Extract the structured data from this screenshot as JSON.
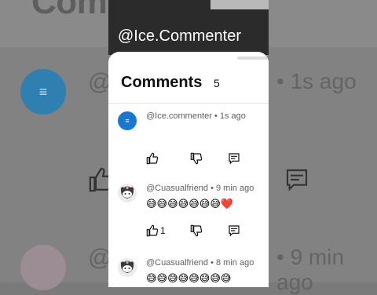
{
  "background": {
    "title": "Comme",
    "comment1": {
      "handle": "@",
      "time": "• 1s ago"
    },
    "comment2": {
      "handle": "@",
      "time": "• 9 min ago"
    }
  },
  "video_overlay_handle": "@Ice.Commenter",
  "panel": {
    "title": "Comments",
    "count": "5"
  },
  "comments": [
    {
      "meta": "@Ice.commenter • 1s ago",
      "text": "",
      "likes": ""
    },
    {
      "meta": "@Cuasualfriend • 9 min ago",
      "text": "😅😅😅😅😅😅😅❤️",
      "likes": "1"
    },
    {
      "meta": "@Cuasualfriend • 8 min ago",
      "text": "😅😅😅😅😅😅😅😅",
      "likes": ""
    }
  ],
  "icons": {
    "like": "thumbs-up-icon",
    "dislike": "thumbs-down-icon",
    "reply": "reply-icon",
    "avatar_blue": "ice-avatar",
    "avatar_kuromi": "kuromi-avatar"
  },
  "colors": {
    "avatar_blue": "#1976d2",
    "heart": "#e0245e"
  }
}
